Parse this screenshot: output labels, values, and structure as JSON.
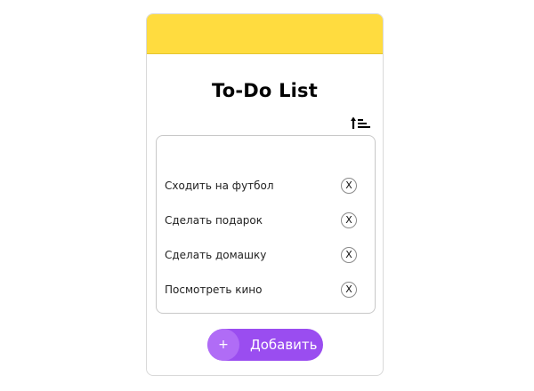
{
  "app": {
    "title": "To-Do List",
    "header_color": "#ffdc3f",
    "accent_color": "#9a4df0"
  },
  "toolbar": {
    "sort_icon": "sort-ascending-icon"
  },
  "tasks": [
    {
      "label": "Сходить на футбол",
      "delete_label": "X"
    },
    {
      "label": "Сделать подарок",
      "delete_label": "X"
    },
    {
      "label": "Сделать домашку",
      "delete_label": "X"
    },
    {
      "label": "Посмотреть кино",
      "delete_label": "X"
    }
  ],
  "add_button": {
    "icon": "+",
    "label": "Добавить"
  }
}
